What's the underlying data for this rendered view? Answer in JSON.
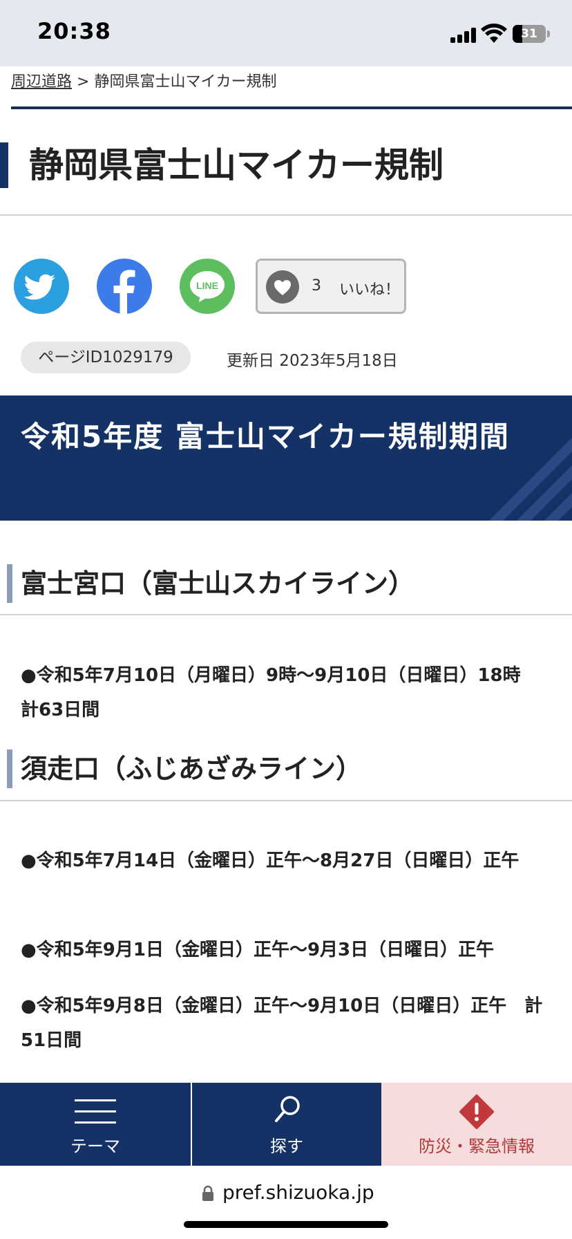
{
  "status_bar": {
    "time": "20:38",
    "battery": "31"
  },
  "breadcrumb": {
    "parent": "周辺道路",
    "separator": ">",
    "current": "静岡県富士山マイカー規制"
  },
  "page": {
    "title": "静岡県富士山マイカー規制",
    "page_id": "ページID1029179",
    "updated": "更新日 2023年5月18日"
  },
  "share": {
    "twitter_icon": "twitter-bird-icon",
    "facebook_icon": "facebook-f-icon",
    "line_icon": "line-icon",
    "line_text": "LINE",
    "like_count": "3",
    "like_label": "いいね！"
  },
  "banner": {
    "title": "令和5年度 富士山マイカー規制期間"
  },
  "sections": [
    {
      "heading": "富士宮口（富士山スカイライン）",
      "items": [
        "●令和5年7月10日（月曜日）9時～9月10日（日曜日）18時　計63日間"
      ]
    },
    {
      "heading": "須走口（ふじあざみライン）",
      "items": [
        "●令和5年7月14日（金曜日）正午～8月27日（日曜日）正午",
        "●令和5年9月1日（金曜日）正午～9月3日（日曜日）正午",
        "●令和5年9月8日（金曜日）正午～9月10日（日曜日）正午　計51日間"
      ]
    }
  ],
  "bottom_nav": {
    "theme": "テーマ",
    "search": "探す",
    "emergency": "防災・緊急情報"
  },
  "browser": {
    "url": "pref.shizuoka.jp"
  },
  "colors": {
    "navy": "#153266",
    "emergency_bg": "#f6dcdc",
    "emergency_text": "#b0383a",
    "emergency_icon": "#c0383a"
  }
}
